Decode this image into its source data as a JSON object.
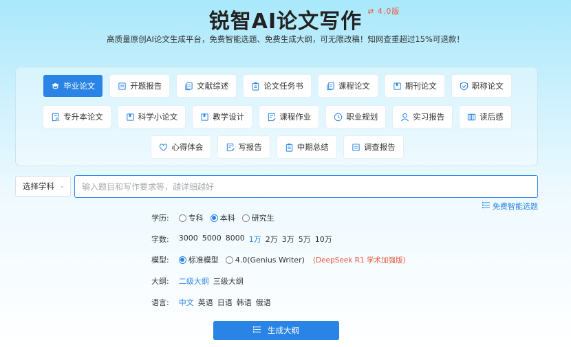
{
  "header": {
    "title": "锐智AI论文写作",
    "version": "⇄ 4.0版",
    "subtitle": "高质量原创AI论文生成平台，免费智能选题、免费生成大纲，可无限改稿！知网查重超过15%可退款！"
  },
  "paper_types": {
    "row1": [
      {
        "label": "毕业论文",
        "icon": "graduation-cap-icon",
        "active": true
      },
      {
        "label": "开题报告",
        "icon": "report-icon"
      },
      {
        "label": "文献综述",
        "icon": "documents-icon"
      },
      {
        "label": "论文任务书",
        "icon": "clipboard-icon"
      },
      {
        "label": "课程论文",
        "icon": "documents-icon"
      },
      {
        "label": "期刊论文",
        "icon": "journal-icon"
      },
      {
        "label": "职称论文",
        "icon": "shield-icon"
      }
    ],
    "row2": [
      {
        "label": "专升本论文",
        "icon": "doc-search-icon"
      },
      {
        "label": "科学小论文",
        "icon": "journal-icon"
      },
      {
        "label": "教学设计",
        "icon": "journal-icon"
      },
      {
        "label": "课程作业",
        "icon": "doc-edit-icon"
      },
      {
        "label": "职业规划",
        "icon": "clock-icon"
      },
      {
        "label": "实习报告",
        "icon": "user-icon"
      },
      {
        "label": "读后感",
        "icon": "book-icon"
      }
    ],
    "row3": [
      {
        "label": "心得体会",
        "icon": "heart-icon"
      },
      {
        "label": "写报告",
        "icon": "doc-edit-icon"
      },
      {
        "label": "中期总结",
        "icon": "clipboard-icon"
      },
      {
        "label": "调查报告",
        "icon": "report-icon"
      }
    ]
  },
  "subject_select": {
    "label": "选择学科"
  },
  "topic_input": {
    "placeholder": "输入题目和写作要求等，越详细越好",
    "value": ""
  },
  "free_topic": {
    "label": "免费智能选题"
  },
  "options": {
    "education": {
      "label": "学历:",
      "choices": [
        "专科",
        "本科",
        "研究生"
      ],
      "selected": "本科"
    },
    "words": {
      "label": "字数:",
      "choices": [
        "3000",
        "5000",
        "8000",
        "1万",
        "2万",
        "3万",
        "5万",
        "10万"
      ],
      "selected": "1万"
    },
    "model": {
      "label": "模型:",
      "choices": [
        "标准模型",
        "4.0(Genius Writer)"
      ],
      "selected": "标准模型",
      "note": "(DeepSeek R1 学术加强版)"
    },
    "outline": {
      "label": "大纲:",
      "choices": [
        "二级大纲",
        "三级大纲"
      ],
      "selected": "二级大纲"
    },
    "language": {
      "label": "语言:",
      "choices": [
        "中文",
        "英语",
        "日语",
        "韩语",
        "俄语"
      ],
      "selected": "中文"
    }
  },
  "generate": {
    "label": "生成大纲"
  },
  "colors": {
    "accent": "#2a84e6",
    "highlight": "#e8553a"
  }
}
